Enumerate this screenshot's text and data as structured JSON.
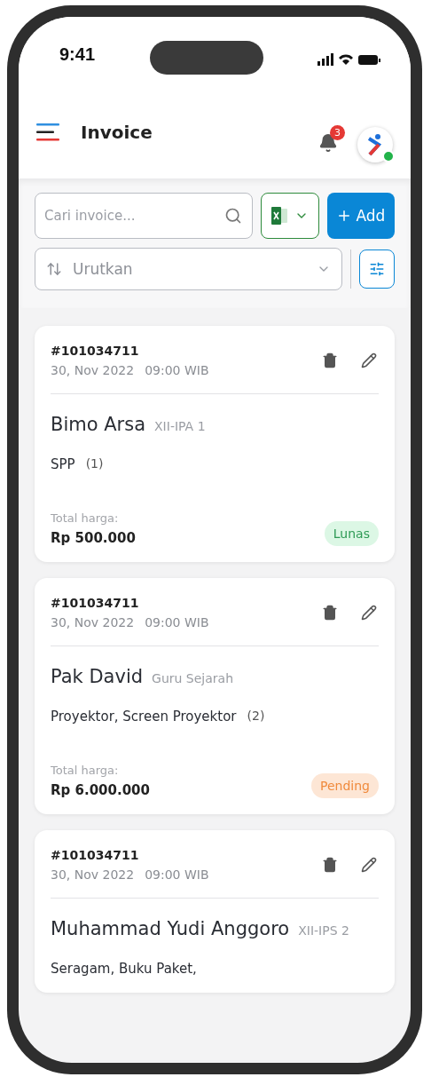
{
  "status_bar": {
    "time": "9:41"
  },
  "header": {
    "title": "Invoice",
    "notifications": "3",
    "online": true
  },
  "search": {
    "placeholder": "Cari invoice..."
  },
  "add_button": {
    "label": "Add"
  },
  "sort": {
    "placeholder": "Urutkan"
  },
  "invoices": [
    {
      "id": "#101034711",
      "date": "30, Nov 2022",
      "time": "09:00 WIB",
      "name": "Bimo Arsa",
      "group": "XII-IPA 1",
      "items": "SPP",
      "count": "(1)",
      "total_label": "Total harga:",
      "total": "Rp 500.000",
      "status": {
        "label": "Lunas",
        "kind": "paid"
      }
    },
    {
      "id": "#101034711",
      "date": "30, Nov 2022",
      "time": "09:00 WIB",
      "name": "Pak David",
      "group": "Guru Sejarah",
      "items": "Proyektor, Screen Proyektor",
      "count": "(2)",
      "total_label": "Total harga:",
      "total": "Rp 6.000.000",
      "status": {
        "label": "Pending",
        "kind": "pending"
      }
    },
    {
      "id": "#101034711",
      "date": "30, Nov 2022",
      "time": "09:00 WIB",
      "name": "Muhammad Yudi Anggoro",
      "group": "XII-IPS 2",
      "items": "Seragam, Buku Paket,"
    }
  ]
}
